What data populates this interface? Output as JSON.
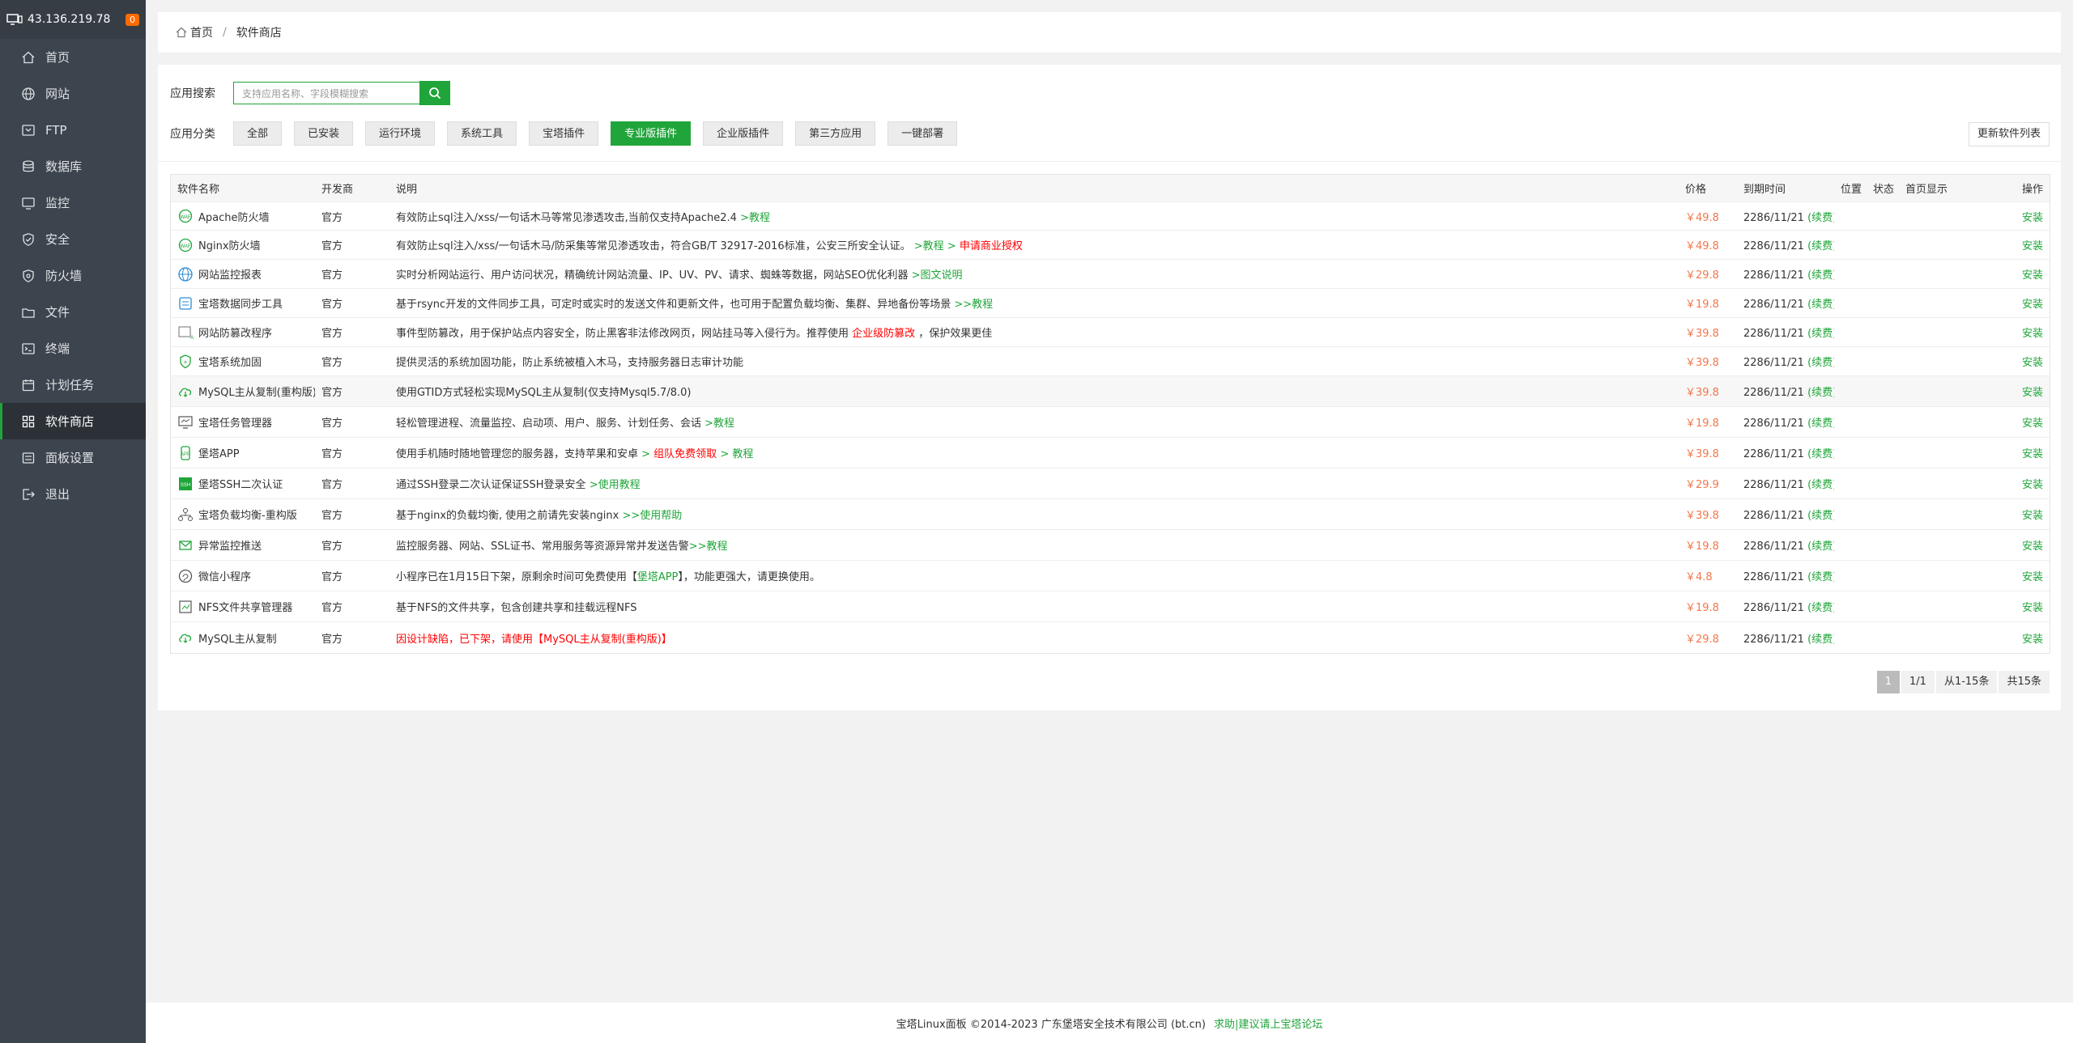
{
  "sidebar": {
    "ip": "43.136.219.78",
    "badge": "0",
    "items": [
      {
        "label": "首页",
        "icon": "home-icon"
      },
      {
        "label": "网站",
        "icon": "globe-icon"
      },
      {
        "label": "FTP",
        "icon": "ftp-icon"
      },
      {
        "label": "数据库",
        "icon": "database-icon"
      },
      {
        "label": "监控",
        "icon": "monitor-icon"
      },
      {
        "label": "安全",
        "icon": "shield-icon"
      },
      {
        "label": "防火墙",
        "icon": "firewall-icon"
      },
      {
        "label": "文件",
        "icon": "folder-icon"
      },
      {
        "label": "终端",
        "icon": "terminal-icon"
      },
      {
        "label": "计划任务",
        "icon": "calendar-icon"
      },
      {
        "label": "软件商店",
        "icon": "grid-icon"
      },
      {
        "label": "面板设置",
        "icon": "settings-icon"
      },
      {
        "label": "退出",
        "icon": "logout-icon"
      }
    ],
    "active_index": 10
  },
  "breadcrumb": {
    "home": "首页",
    "current": "软件商店"
  },
  "search": {
    "label": "应用搜索",
    "placeholder": "支持应用名称、字段模糊搜索"
  },
  "categories": {
    "label": "应用分类",
    "items": [
      "全部",
      "已安装",
      "运行环境",
      "系统工具",
      "宝塔插件",
      "专业版插件",
      "企业版插件",
      "第三方应用",
      "一键部署"
    ],
    "selected_index": 5
  },
  "refresh_button": "更新软件列表",
  "table": {
    "headers": [
      "软件名称",
      "开发商",
      "说明",
      "价格",
      "到期时间",
      "位置",
      "状态",
      "首页显示",
      "操作"
    ],
    "rows": [
      {
        "name": "Apache防火墙",
        "dev": "官方",
        "desc": "有效防止sql注入/xss/一句话木马等常见渗透攻击,当前仅支持Apache2.4 ",
        "desc_links": [
          {
            "text": ">教程",
            "color": "green"
          }
        ],
        "price": "￥49.8",
        "expire": "2286/11/21",
        "renew": "(续费)",
        "action": "安装",
        "name_red": false
      },
      {
        "name": "Nginx防火墙",
        "dev": "官方",
        "desc": "有效防止sql注入/xss/一句话木马/防采集等常见渗透攻击，符合GB/T 32917-2016标准，公安三所安全认证。 ",
        "desc_links": [
          {
            "text": ">教程",
            "color": "green"
          },
          {
            "text": " > ",
            "color": "green"
          },
          {
            "text": "申请商业授权",
            "color": "red"
          }
        ],
        "price": "￥49.8",
        "expire": "2286/11/21",
        "renew": "(续费)",
        "action": "安装"
      },
      {
        "name": "网站监控报表",
        "dev": "官方",
        "desc": "实时分析网站运行、用户访问状况，精确统计网站流量、IP、UV、PV、请求、蜘蛛等数据，网站SEO优化利器 ",
        "desc_links": [
          {
            "text": ">图文说明",
            "color": "green"
          }
        ],
        "price": "￥29.8",
        "expire": "2286/11/21",
        "renew": "(续费)",
        "action": "安装"
      },
      {
        "name": "宝塔数据同步工具",
        "dev": "官方",
        "desc": "基于rsync开发的文件同步工具，可定时或实时的发送文件和更新文件，也可用于配置负载均衡、集群、异地备份等场景 ",
        "desc_links": [
          {
            "text": ">>教程",
            "color": "green"
          }
        ],
        "price": "￥19.8",
        "expire": "2286/11/21",
        "renew": "(续费)",
        "action": "安装"
      },
      {
        "name": "网站防篡改程序",
        "dev": "官方",
        "desc": "事件型防篡改，用于保护站点内容安全，防止黑客非法修改网页，网站挂马等入侵行为。推荐使用 ",
        "desc_links": [
          {
            "text": "企业级防篡改",
            "color": "red"
          },
          {
            "text": " ，保护效果更佳",
            "color": "plain"
          }
        ],
        "price": "￥39.8",
        "expire": "2286/11/21",
        "renew": "(续费)",
        "action": "安装"
      },
      {
        "name": "宝塔系统加固",
        "dev": "官方",
        "desc": "提供灵活的系统加固功能，防止系统被植入木马，支持服务器日志审计功能",
        "desc_links": [],
        "price": "￥39.8",
        "expire": "2286/11/21",
        "renew": "(续费)",
        "action": "安装"
      },
      {
        "name": "MySQL主从复制(重构版)",
        "dev": "官方",
        "desc": "使用GTID方式轻松实现MySQL主从复制(仅支持Mysql5.7/8.0)",
        "desc_links": [],
        "price": "￥39.8",
        "expire": "2286/11/21",
        "renew": "(续费)",
        "action": "安装"
      },
      {
        "name": "宝塔任务管理器",
        "dev": "官方",
        "desc": "轻松管理进程、流量监控、启动项、用户、服务、计划任务、会话 ",
        "desc_links": [
          {
            "text": ">教程",
            "color": "green"
          }
        ],
        "price": "￥19.8",
        "expire": "2286/11/21",
        "renew": "(续费)",
        "action": "安装"
      },
      {
        "name": "堡塔APP",
        "dev": "官方",
        "desc": "使用手机随时随地管理您的服务器，支持苹果和安卓 ",
        "desc_links": [
          {
            "text": ">",
            "color": "green"
          },
          {
            "text": " 组队免费领取 ",
            "color": "red"
          },
          {
            "text": "> 教程",
            "color": "green"
          }
        ],
        "price": "￥39.8",
        "expire": "2286/11/21",
        "renew": "(续费)",
        "action": "安装"
      },
      {
        "name": "堡塔SSH二次认证",
        "dev": "官方",
        "desc": "通过SSH登录二次认证保证SSH登录安全 ",
        "desc_links": [
          {
            "text": ">使用教程",
            "color": "green"
          }
        ],
        "price": "￥29.9",
        "expire": "2286/11/21",
        "renew": "(续费)",
        "action": "安装"
      },
      {
        "name": "宝塔负载均衡-重构版",
        "dev": "官方",
        "desc": "基于nginx的负载均衡, 使用之前请先安装nginx ",
        "desc_links": [
          {
            "text": ">>使用帮助",
            "color": "green"
          }
        ],
        "price": "￥39.8",
        "expire": "2286/11/21",
        "renew": "(续费)",
        "action": "安装"
      },
      {
        "name": "异常监控推送",
        "dev": "官方",
        "desc": "监控服务器、网站、SSL证书、常用服务等资源异常并发送告警",
        "desc_links": [
          {
            "text": ">>教程",
            "color": "green"
          }
        ],
        "price": "￥19.8",
        "expire": "2286/11/21",
        "renew": "(续费)",
        "action": "安装"
      },
      {
        "name": "微信小程序",
        "dev": "官方",
        "desc": "小程序已在1月15日下架，原剩余时间可免费使用【",
        "desc_links": [
          {
            "text": "堡塔APP",
            "color": "green"
          },
          {
            "text": "】，功能更强大，请更换使用。",
            "color": "plain"
          }
        ],
        "price": "￥4.8",
        "expire": "2286/11/21",
        "renew": "(续费)",
        "action": "安装"
      },
      {
        "name": "NFS文件共享管理器",
        "dev": "官方",
        "desc": "基于NFS的文件共享，包含创建共享和挂载远程NFS",
        "desc_links": [],
        "price": "￥19.8",
        "expire": "2286/11/21",
        "renew": "(续费)",
        "action": "安装"
      },
      {
        "name": "MySQL主从复制",
        "dev": "官方",
        "desc": "",
        "desc_links": [
          {
            "text": "因设计缺陷，已下架，请使用【MySQL主从复制(重构版)】",
            "color": "red"
          }
        ],
        "price": "￥29.8",
        "expire": "2286/11/21",
        "renew": "(续费)",
        "action": "安装"
      }
    ]
  },
  "pager": {
    "current": "1",
    "pages": "1/1",
    "range": "从1-15条",
    "total": "共15条"
  },
  "footer": {
    "copyright": "宝塔Linux面板 ©2014-2023 广东堡塔安全技术有限公司 (bt.cn)",
    "link": "求助|建议请上宝塔论坛"
  },
  "colors": {
    "accent": "#20a53a",
    "sidebar": "#3c444d",
    "price": "#f0774c",
    "warn": "#ff0000"
  }
}
